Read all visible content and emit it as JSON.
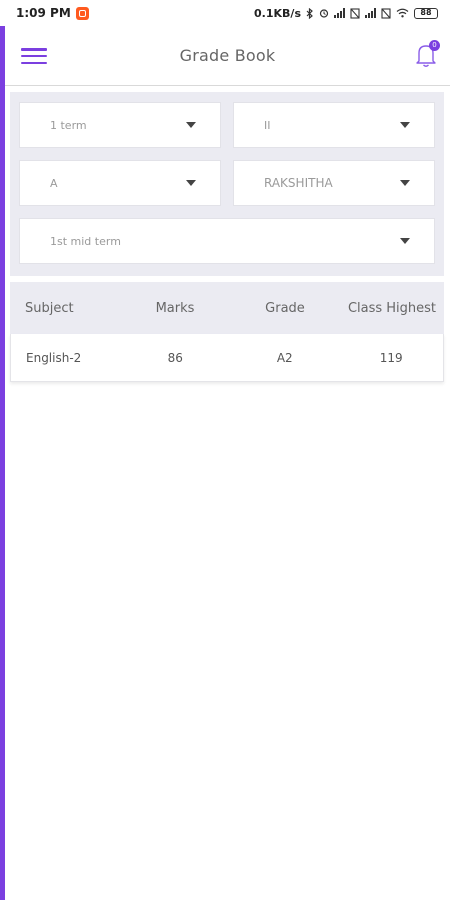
{
  "status_bar": {
    "time": "1:09 PM",
    "net_speed": "0.1KB/s",
    "battery": "88"
  },
  "header": {
    "title": "Grade Book",
    "notification_count": "0"
  },
  "filters": {
    "term": "1 term",
    "class": "II",
    "section": "A",
    "student": "RAKSHITHA",
    "exam": "1st mid term"
  },
  "table": {
    "headers": [
      "Subject",
      "Marks",
      "Grade",
      "Class Highest"
    ],
    "rows": [
      [
        "English-2",
        "86",
        "A2",
        "119"
      ]
    ]
  },
  "colors": {
    "accent": "#7b3fe0",
    "panel_bg": "#ebebf2"
  },
  "icons": [
    "menu-icon",
    "bell-icon",
    "caret-down-icon",
    "bluetooth-icon",
    "wifi-icon",
    "battery-icon"
  ]
}
